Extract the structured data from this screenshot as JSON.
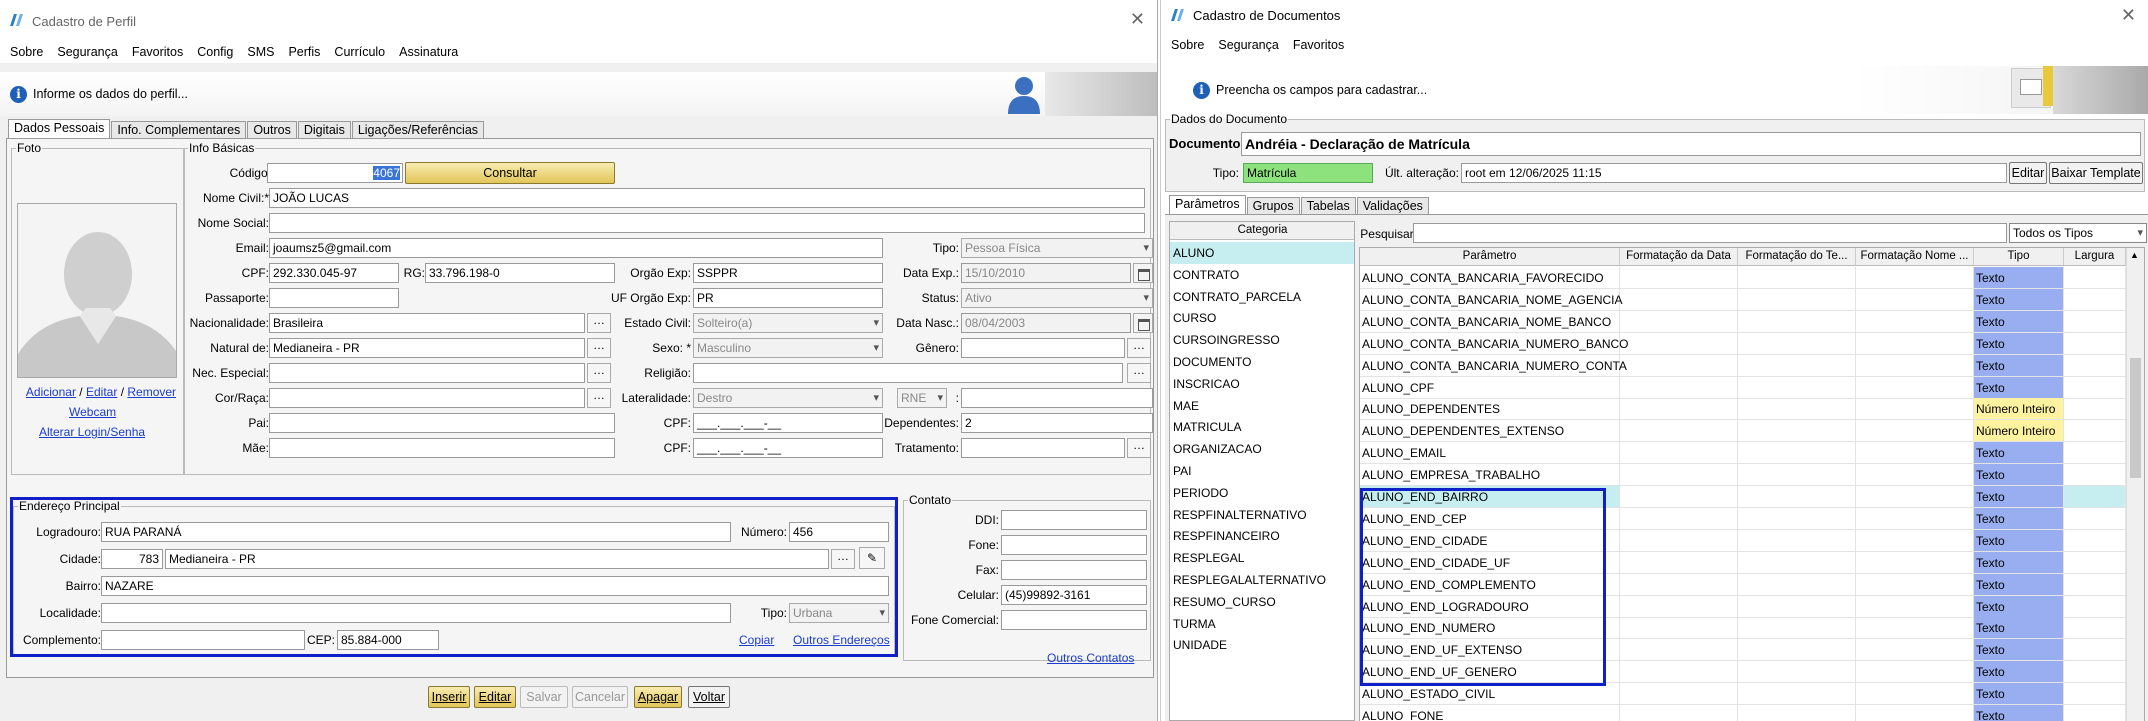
{
  "perfil": {
    "title": "Cadastro de Perfil",
    "menu": [
      "Sobre",
      "Segurança",
      "Favoritos",
      "Config",
      "SMS",
      "Perfis",
      "Currículo",
      "Assinatura"
    ],
    "info": "Informe os dados do perfil...",
    "tabs": [
      "Dados Pessoais",
      "Info. Complementares",
      "Outros",
      "Digitais",
      "Ligações/Referências"
    ],
    "foto": {
      "legend": "Foto",
      "adicionar": "Adicionar",
      "editar": "Editar",
      "remover": "Remover",
      "sep": "/",
      "webcam": "Webcam",
      "alterar": "Alterar Login/Senha"
    },
    "basicas": {
      "legend": "Info Básicas",
      "codigo_label": "Código:",
      "codigo": "4067",
      "consultar": "Consultar",
      "nome_civil_label": "Nome Civil:*",
      "nome_civil": "JOÃO LUCAS",
      "nome_social_label": "Nome Social:",
      "nome_social": "",
      "email_label": "Email:",
      "email": "joaumsz5@gmail.com",
      "tipo_label": "Tipo:",
      "tipo": "Pessoa Física",
      "cpf_label": "CPF:",
      "cpf": "292.330.045-97",
      "rg_label": "RG:",
      "rg": "33.796.198-0",
      "orgao_label": "Orgão Exp:",
      "orgao": "SSPPR",
      "dataexp_label": "Data Exp.:",
      "dataexp": "15/10/2010",
      "passaporte_label": "Passaporte:",
      "passaporte": "",
      "uf_label": "UF Orgão Exp:",
      "uf": "PR",
      "status_label": "Status:",
      "status": "Ativo",
      "nac_label": "Nacionalidade:",
      "nac": "Brasileira",
      "civil_label": "Estado Civil:",
      "civil": "Solteiro(a)",
      "nasc_label": "Data Nasc.:",
      "nasc": "08/04/2003",
      "natural_label": "Natural de:",
      "natural": "Medianeira - PR",
      "sexo_label": "Sexo: *",
      "sexo": "Masculino",
      "genero_label": "Gênero:",
      "genero": "",
      "nec_label": "Nec. Especial:",
      "nec": "",
      "religiao_label": "Religião:",
      "religiao": "",
      "cor_label": "Cor/Raça:",
      "cor": "",
      "lateral_label": "Lateralidade:",
      "lateral": "Destro",
      "rne": "RNE",
      "pai_label": "Pai:",
      "pai": "",
      "cpf_pai_label": "CPF:",
      "cpf_pai": "___.___.___-__",
      "dependentes_label": "Dependentes:",
      "dependentes": "2",
      "mae_label": "Mãe:",
      "mae": "",
      "cpf_mae_label": "CPF:",
      "cpf_mae": "___.___.___-__",
      "tratamento_label": "Tratamento:",
      "tratamento": ""
    },
    "endereco": {
      "legend": "Endereço Principal",
      "logradouro_label": "Logradouro:",
      "logradouro": "RUA PARANÁ",
      "numero_label": "Número:",
      "numero": "456",
      "cidade_label": "Cidade:",
      "cidade_cod": "783",
      "cidade": "Medianeira - PR",
      "bairro_label": "Bairro:",
      "bairro": "NAZARE",
      "localidade_label": "Localidade:",
      "localidade": "",
      "tipo_label": "Tipo:",
      "tipo": "Urbana",
      "complemento_label": "Complemento:",
      "complemento": "",
      "cep_label": "CEP:",
      "cep": "85.884-000",
      "copiar": "Copiar",
      "outros": "Outros Endereços"
    },
    "contato": {
      "legend": "Contato",
      "ddi_label": "DDI:",
      "ddi": "",
      "fone_label": "Fone:",
      "fone": "",
      "fax_label": "Fax:",
      "fax": "",
      "celular_label": "Celular:",
      "celular": "(45)99892-3161",
      "comercial_label": "Fone Comercial:",
      "comercial": "",
      "outros": "Outros Contatos"
    },
    "buttons": [
      "Inserir",
      "Editar",
      "Salvar",
      "Cancelar",
      "Apagar",
      "Voltar"
    ]
  },
  "documentos": {
    "title": "Cadastro de Documentos",
    "menu": [
      "Sobre",
      "Segurança",
      "Favoritos"
    ],
    "info": "Preencha os campos para cadastrar...",
    "dados_legend": "Dados do Documento",
    "documento_label": "Documento:",
    "documento": "Andréia - Declaração de Matrícula",
    "tipo_label": "Tipo:",
    "tipo": "Matrícula",
    "ult_label": "Últ. alteração:",
    "ult": "root em 12/06/2025 11:15",
    "editar": "Editar",
    "baixar": "Baixar Template",
    "tabs": [
      "Parâmetros",
      "Grupos",
      "Tabelas",
      "Validações"
    ],
    "categoria_header": "Categoria",
    "categorias": [
      "ALUNO",
      "CONTRATO",
      "CONTRATO_PARCELA",
      "CURSO",
      "CURSOINGRESSO",
      "DOCUMENTO",
      "INSCRICAO",
      "MAE",
      "MATRICULA",
      "ORGANIZACAO",
      "PAI",
      "PERIODO",
      "RESPFINALTERNATIVO",
      "RESPFINANCEIRO",
      "RESPLEGAL",
      "RESPLEGALALTERNATIVO",
      "RESUMO_CURSO",
      "TURMA",
      "UNIDADE"
    ],
    "pesquisar_label": "Pesquisar:",
    "pesquisar": "",
    "filtro": "Todos os Tipos",
    "columns": [
      "Parâmetro",
      "Formatação da Data",
      "Formatação do Te...",
      "Formatação Nome ...",
      "Tipo",
      "Largura"
    ],
    "rows": [
      {
        "param": "ALUNO_CONTA_BANCARIA_FAVORECIDO",
        "tipo": "Texto"
      },
      {
        "param": "ALUNO_CONTA_BANCARIA_NOME_AGENCIA",
        "tipo": "Texto"
      },
      {
        "param": "ALUNO_CONTA_BANCARIA_NOME_BANCO",
        "tipo": "Texto"
      },
      {
        "param": "ALUNO_CONTA_BANCARIA_NUMERO_BANCO",
        "tipo": "Texto"
      },
      {
        "param": "ALUNO_CONTA_BANCARIA_NUMERO_CONTA",
        "tipo": "Texto"
      },
      {
        "param": "ALUNO_CPF",
        "tipo": "Texto"
      },
      {
        "param": "ALUNO_DEPENDENTES",
        "tipo": "Número Inteiro"
      },
      {
        "param": "ALUNO_DEPENDENTES_EXTENSO",
        "tipo": "Número Inteiro"
      },
      {
        "param": "ALUNO_EMAIL",
        "tipo": "Texto"
      },
      {
        "param": "ALUNO_EMPRESA_TRABALHO",
        "tipo": "Texto"
      },
      {
        "param": "ALUNO_END_BAIRRO",
        "tipo": "Texto"
      },
      {
        "param": "ALUNO_END_CEP",
        "tipo": "Texto"
      },
      {
        "param": "ALUNO_END_CIDADE",
        "tipo": "Texto"
      },
      {
        "param": "ALUNO_END_CIDADE_UF",
        "tipo": "Texto"
      },
      {
        "param": "ALUNO_END_COMPLEMENTO",
        "tipo": "Texto"
      },
      {
        "param": "ALUNO_END_LOGRADOURO",
        "tipo": "Texto"
      },
      {
        "param": "ALUNO_END_NUMERO",
        "tipo": "Texto"
      },
      {
        "param": "ALUNO_END_UF_EXTENSO",
        "tipo": "Texto"
      },
      {
        "param": "ALUNO_END_UF_GENERO",
        "tipo": "Texto"
      },
      {
        "param": "ALUNO_ESTADO_CIVIL",
        "tipo": "Texto"
      },
      {
        "param": "ALUNO_FONE",
        "tipo": "Texto"
      }
    ],
    "colors": {
      "texto": "#99aef0",
      "numero": "#fdf2a0",
      "tipo_matricula": "#8ee27e",
      "selected": "#c6eef0"
    }
  }
}
